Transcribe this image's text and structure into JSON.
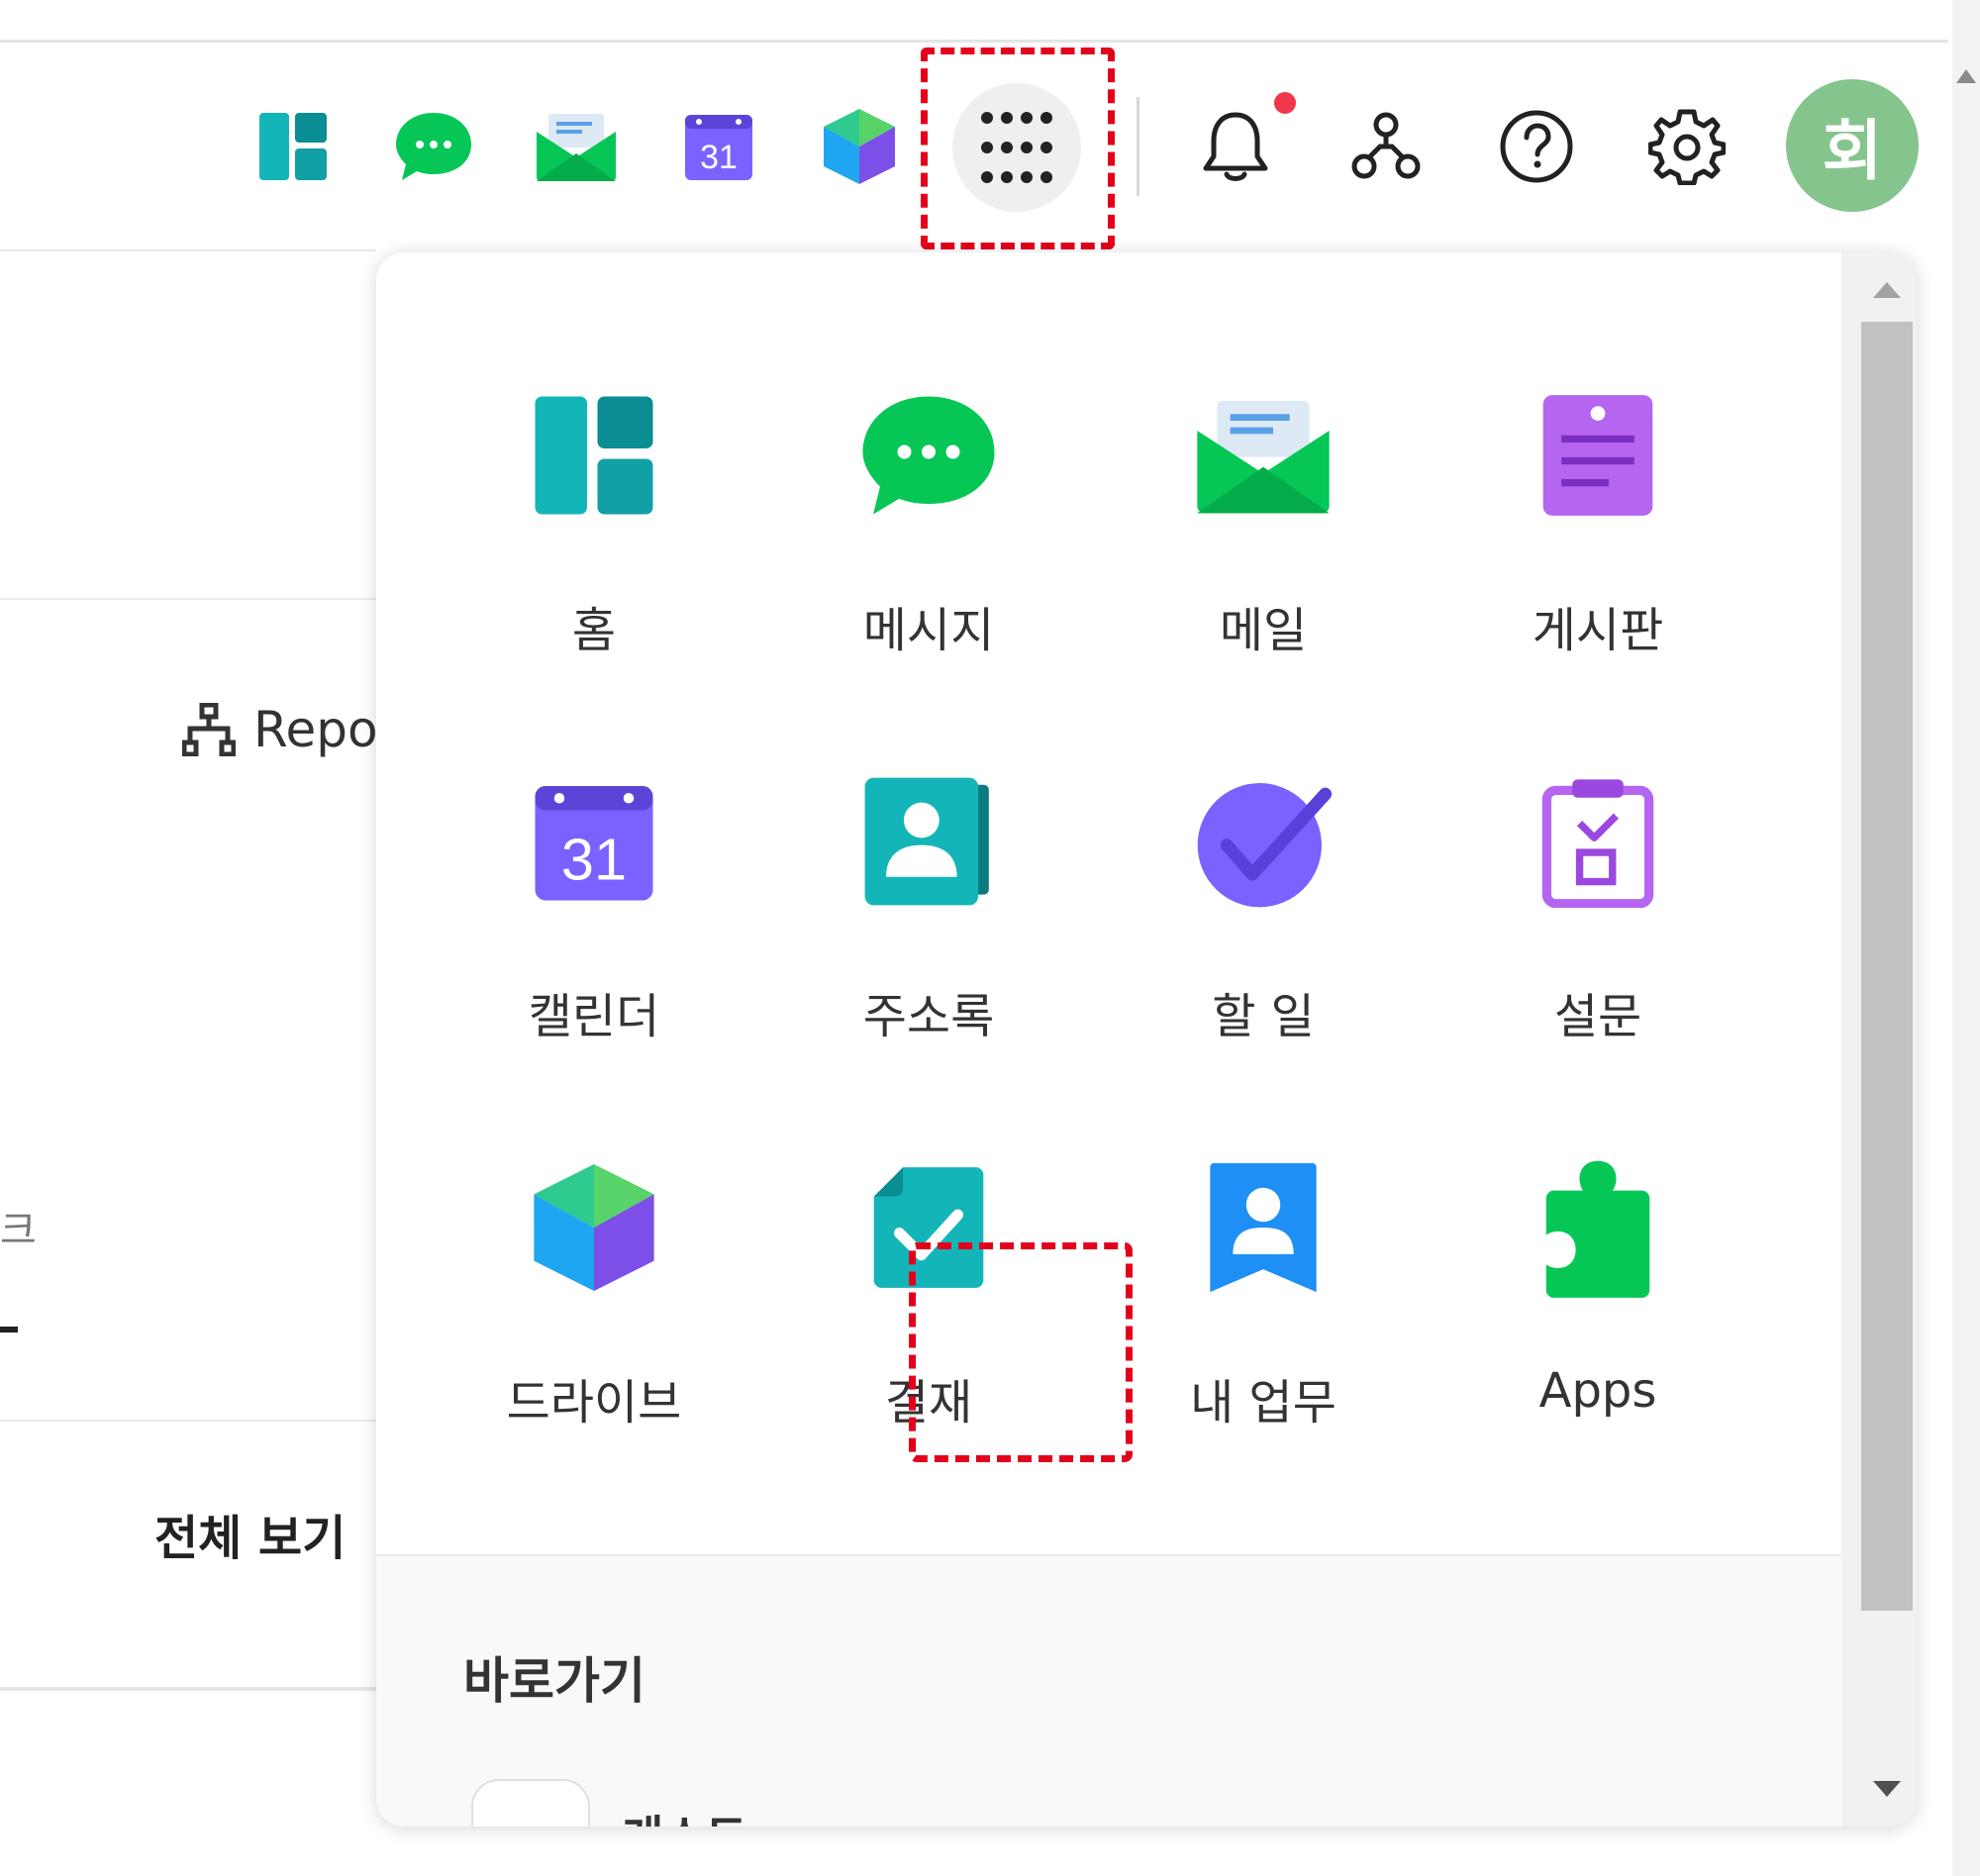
{
  "header": {
    "avatar_initial": "회",
    "icons": [
      "home-icon",
      "messages-icon",
      "mail-icon",
      "calendar-icon",
      "drive-icon",
      "apps-grid-icon",
      "bell-icon",
      "org-chart-icon",
      "help-icon",
      "gear-icon"
    ],
    "calendar_day": "31",
    "notification_dot_color": "#f0384a"
  },
  "background": {
    "report_link": "Repo",
    "fragment": "크",
    "view_all": "전체 보기"
  },
  "apps_panel": {
    "apps": [
      {
        "label": "홈",
        "icon": "home-icon"
      },
      {
        "label": "메시지",
        "icon": "messages-icon"
      },
      {
        "label": "메일",
        "icon": "mail-icon"
      },
      {
        "label": "게시판",
        "icon": "board-icon"
      },
      {
        "label": "캘린더",
        "icon": "calendar-icon",
        "day": "31"
      },
      {
        "label": "주소록",
        "icon": "contacts-icon"
      },
      {
        "label": "할 일",
        "icon": "todo-icon"
      },
      {
        "label": "설문",
        "icon": "survey-icon"
      },
      {
        "label": "드라이브",
        "icon": "drive-icon"
      },
      {
        "label": "결재",
        "icon": "approval-icon"
      },
      {
        "label": "내 업무",
        "icon": "my-work-icon"
      },
      {
        "label": "Apps",
        "icon": "puzzle-icon"
      }
    ],
    "shortcut": {
      "title": "바로가기",
      "item": "게스트"
    }
  },
  "colors": {
    "highlight": "#e3001b",
    "teal": "#0fb1b5",
    "green": "#06c755",
    "purple": "#7b61ff",
    "avatar": "#86c48e"
  }
}
